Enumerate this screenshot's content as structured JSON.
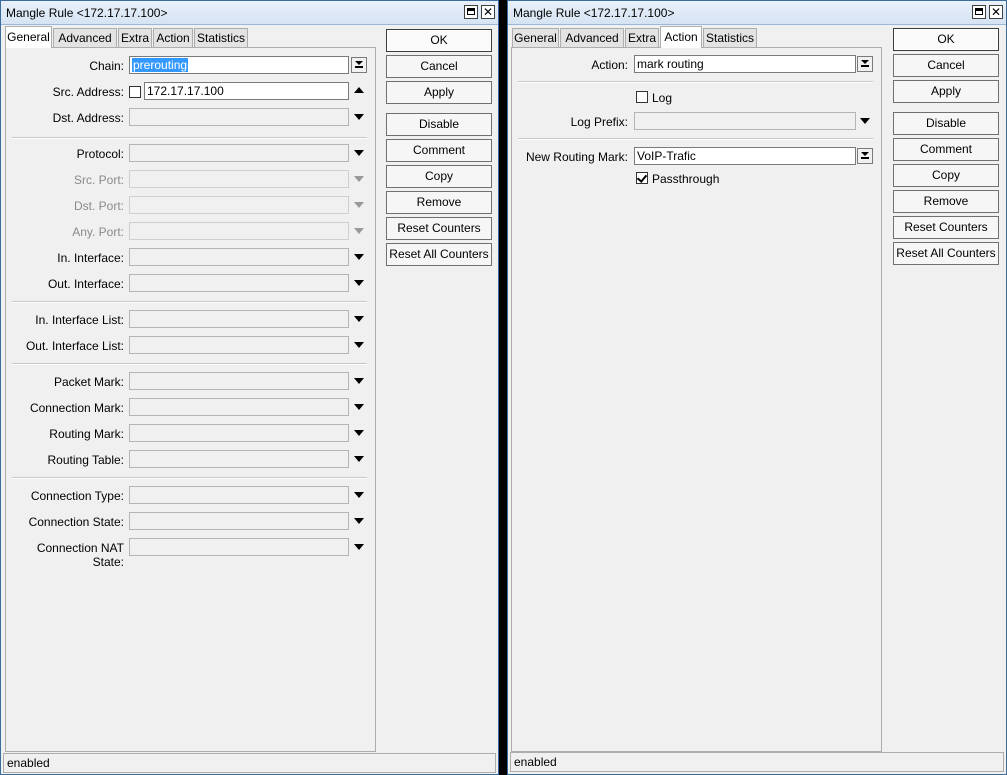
{
  "left_window": {
    "title": "Mangle Rule <172.17.17.100>",
    "tabs": [
      "General",
      "Advanced",
      "Extra",
      "Action",
      "Statistics"
    ],
    "active_tab": "General",
    "fields": {
      "chain": {
        "label": "Chain:",
        "value": "prerouting"
      },
      "src_address": {
        "label": "Src. Address:",
        "value": "172.17.17.100"
      },
      "dst_address": {
        "label": "Dst. Address:",
        "value": ""
      },
      "protocol": {
        "label": "Protocol:",
        "value": ""
      },
      "src_port": {
        "label": "Src. Port:",
        "value": ""
      },
      "dst_port": {
        "label": "Dst. Port:",
        "value": ""
      },
      "any_port": {
        "label": "Any. Port:",
        "value": ""
      },
      "in_interface": {
        "label": "In. Interface:",
        "value": ""
      },
      "out_interface": {
        "label": "Out. Interface:",
        "value": ""
      },
      "in_interface_list": {
        "label": "In. Interface List:",
        "value": ""
      },
      "out_interface_list": {
        "label": "Out. Interface List:",
        "value": ""
      },
      "packet_mark": {
        "label": "Packet Mark:",
        "value": ""
      },
      "connection_mark": {
        "label": "Connection Mark:",
        "value": ""
      },
      "routing_mark": {
        "label": "Routing Mark:",
        "value": ""
      },
      "routing_table": {
        "label": "Routing Table:",
        "value": ""
      },
      "connection_type": {
        "label": "Connection Type:",
        "value": ""
      },
      "connection_state": {
        "label": "Connection State:",
        "value": ""
      },
      "connection_nat_state": {
        "label": "Connection NAT State:",
        "value": ""
      }
    },
    "status": "enabled"
  },
  "right_window": {
    "title": "Mangle Rule <172.17.17.100>",
    "tabs": [
      "General",
      "Advanced",
      "Extra",
      "Action",
      "Statistics"
    ],
    "active_tab": "Action",
    "fields": {
      "action": {
        "label": "Action:",
        "value": "mark routing"
      },
      "log": {
        "label": "Log",
        "checked": false
      },
      "log_prefix": {
        "label": "Log Prefix:",
        "value": ""
      },
      "new_routing_mark": {
        "label": "New Routing Mark:",
        "value": "VoIP-Trafic"
      },
      "passthrough": {
        "label": "Passthrough",
        "checked": true
      }
    },
    "status": "enabled"
  },
  "buttons": {
    "ok": "OK",
    "cancel": "Cancel",
    "apply": "Apply",
    "disable": "Disable",
    "comment": "Comment",
    "copy": "Copy",
    "remove": "Remove",
    "reset_counters": "Reset Counters",
    "reset_all_counters": "Reset All Counters"
  },
  "icons": {
    "maximize": "maximize-icon",
    "close": "close-icon",
    "dropdown": "dropdown-arrow-icon"
  }
}
